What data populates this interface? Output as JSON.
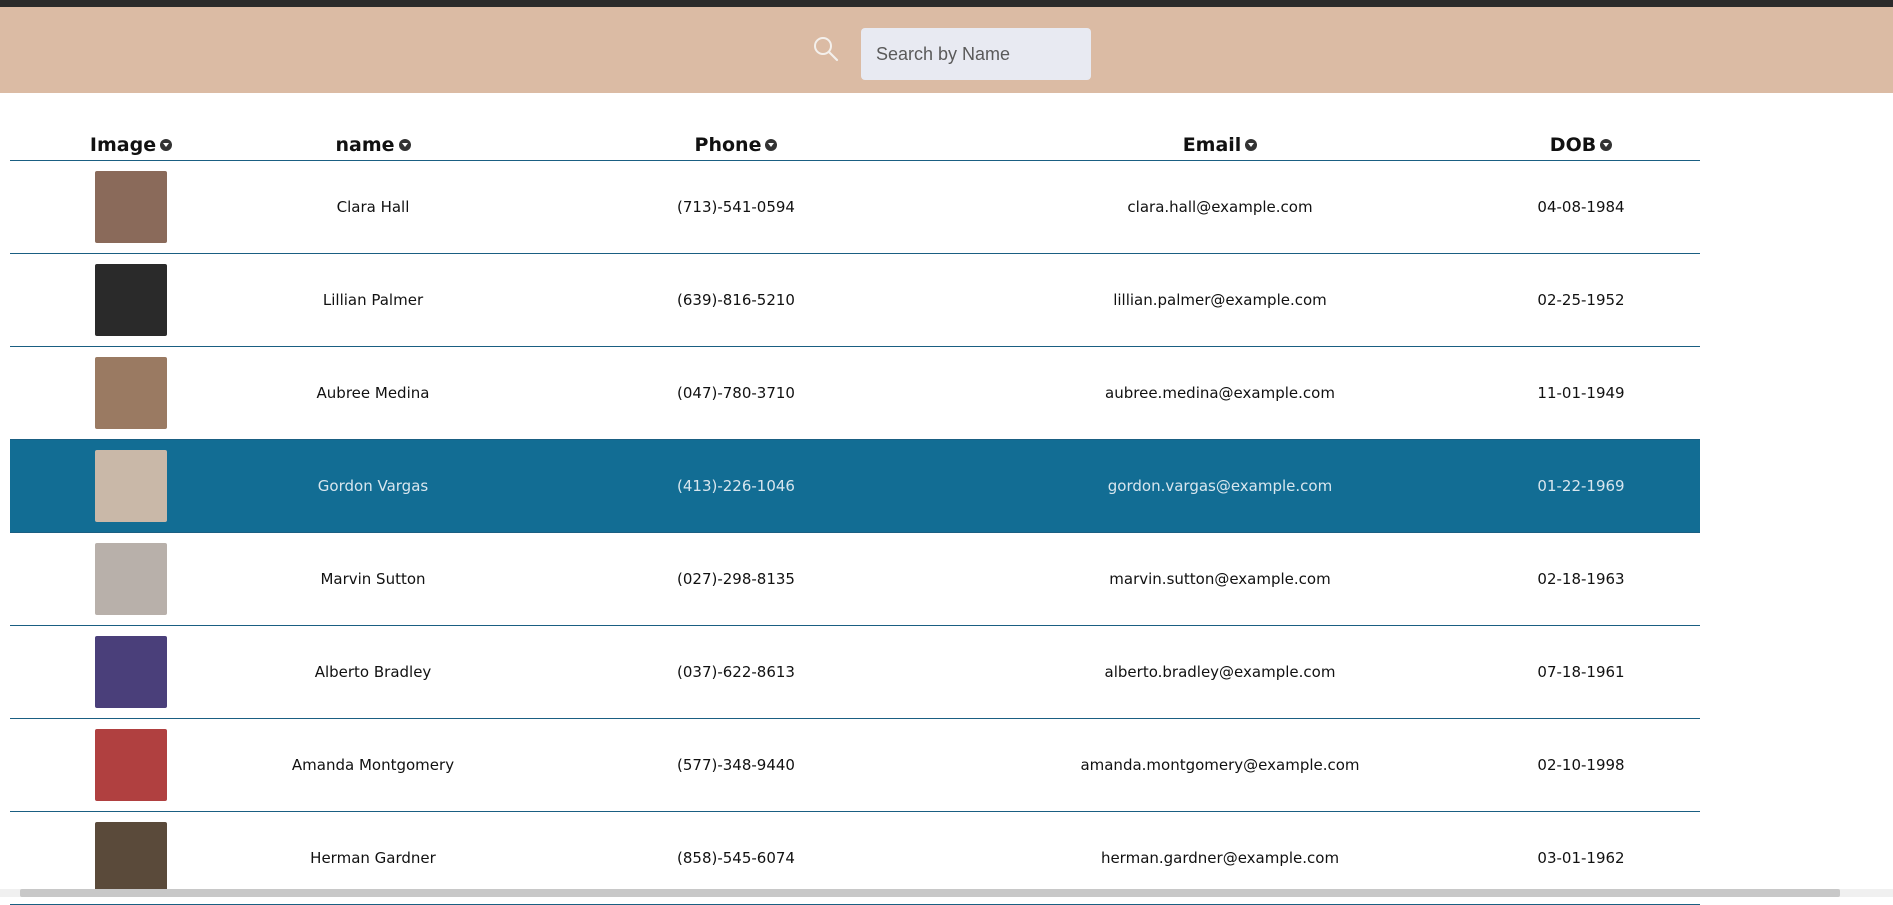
{
  "search": {
    "placeholder": "Search by Name",
    "value": ""
  },
  "table": {
    "columns": [
      "Image",
      "name",
      "Phone",
      "Email",
      "DOB"
    ],
    "rows": [
      {
        "name": "Clara Hall",
        "phone": "(713)-541-0594",
        "email": "clara.hall@example.com",
        "dob": "04-08-1984",
        "avatar_color": "#8a6a5a"
      },
      {
        "name": "Lillian Palmer",
        "phone": "(639)-816-5210",
        "email": "lillian.palmer@example.com",
        "dob": "02-25-1952",
        "avatar_color": "#2a2a2a"
      },
      {
        "name": "Aubree Medina",
        "phone": "(047)-780-3710",
        "email": "aubree.medina@example.com",
        "dob": "11-01-1949",
        "avatar_color": "#9a7a62"
      },
      {
        "name": "Gordon Vargas",
        "phone": "(413)-226-1046",
        "email": "gordon.vargas@example.com",
        "dob": "01-22-1969",
        "avatar_color": "#c9b8a8"
      },
      {
        "name": "Marvin Sutton",
        "phone": "(027)-298-8135",
        "email": "marvin.sutton@example.com",
        "dob": "02-18-1963",
        "avatar_color": "#b8b0aa"
      },
      {
        "name": "Alberto Bradley",
        "phone": "(037)-622-8613",
        "email": "alberto.bradley@example.com",
        "dob": "07-18-1961",
        "avatar_color": "#4a3f7a"
      },
      {
        "name": "Amanda Montgomery",
        "phone": "(577)-348-9440",
        "email": "amanda.montgomery@example.com",
        "dob": "02-10-1998",
        "avatar_color": "#b04040"
      },
      {
        "name": "Herman Gardner",
        "phone": "(858)-545-6074",
        "email": "herman.gardner@example.com",
        "dob": "03-01-1962",
        "avatar_color": "#5a4a3a"
      }
    ],
    "selected_index": 3
  },
  "colors": {
    "header_bg": "#dbbba4",
    "selected_row_bg": "#126d94",
    "row_divider": "#1a5f82"
  }
}
